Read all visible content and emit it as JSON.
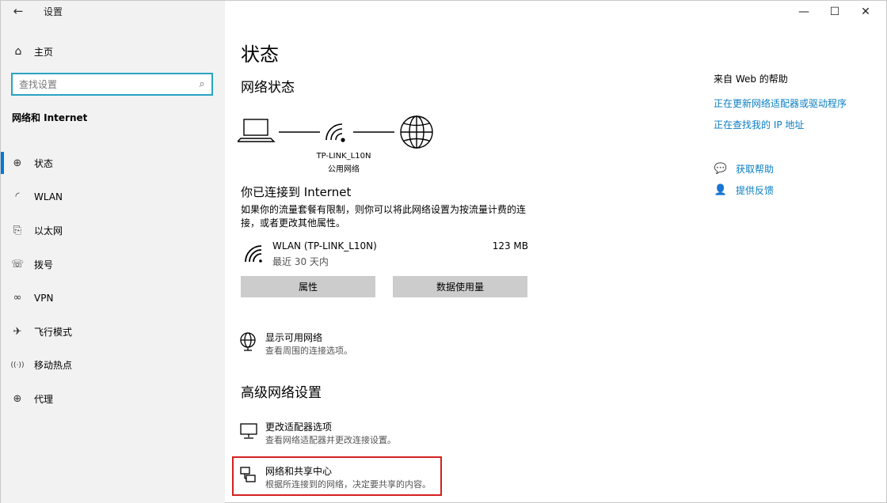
{
  "window": {
    "title": "设置",
    "back_glyph": "←",
    "controls": {
      "minimize": "—",
      "maximize": "☐",
      "close": "✕"
    }
  },
  "sidebar": {
    "home_label": "主页",
    "search_placeholder": "查找设置",
    "section_title": "网络和 Internet",
    "items": [
      {
        "label": "状态",
        "icon": "status-globe-icon",
        "glyph": "⊕",
        "active": true
      },
      {
        "label": "WLAN",
        "icon": "wifi-icon",
        "glyph": "◜",
        "active": false
      },
      {
        "label": "以太网",
        "icon": "ethernet-icon",
        "glyph": "⎘",
        "active": false
      },
      {
        "label": "拨号",
        "icon": "dialup-icon",
        "glyph": "☏",
        "active": false
      },
      {
        "label": "VPN",
        "icon": "vpn-icon",
        "glyph": "∞",
        "active": false
      },
      {
        "label": "飞行模式",
        "icon": "airplane-icon",
        "glyph": "✈",
        "active": false
      },
      {
        "label": "移动热点",
        "icon": "hotspot-icon",
        "glyph": "((·))",
        "active": false
      },
      {
        "label": "代理",
        "icon": "proxy-globe-icon",
        "glyph": "⊕",
        "active": false
      }
    ]
  },
  "main": {
    "page_title": "状态",
    "network_status_heading": "网络状态",
    "network_name": "TP-LINK_L10N",
    "network_type": "公用网络",
    "connected_title": "你已连接到 Internet",
    "connected_desc": "如果你的流量套餐有限制，则你可以将此网络设置为按流量计费的连接，或者更改其他属性。",
    "wlan": {
      "name": "WLAN (TP-LINK_L10N)",
      "period": "最近 30 天内",
      "usage": "123 MB"
    },
    "buttons": {
      "properties": "属性",
      "data_usage": "数据使用量"
    },
    "show_networks": {
      "title": "显示可用网络",
      "desc": "查看周围的连接选项。"
    },
    "advanced_heading": "高级网络设置",
    "adapter_options": {
      "title": "更改适配器选项",
      "desc": "查看网络适配器并更改连接设置。"
    },
    "sharing_center": {
      "title": "网络和共享中心",
      "desc": "根据所连接到的网络，决定要共享的内容。"
    }
  },
  "help": {
    "title": "来自 Web 的帮助",
    "links": [
      "正在更新网络适配器或驱动程序",
      "正在查找我的 IP 地址"
    ],
    "get_help": "获取帮助",
    "feedback": "提供反馈"
  },
  "colors": {
    "accent": "#0078d7",
    "link": "#0b7fc4",
    "highlight": "#d42020",
    "search_border": "#29a3c2"
  }
}
